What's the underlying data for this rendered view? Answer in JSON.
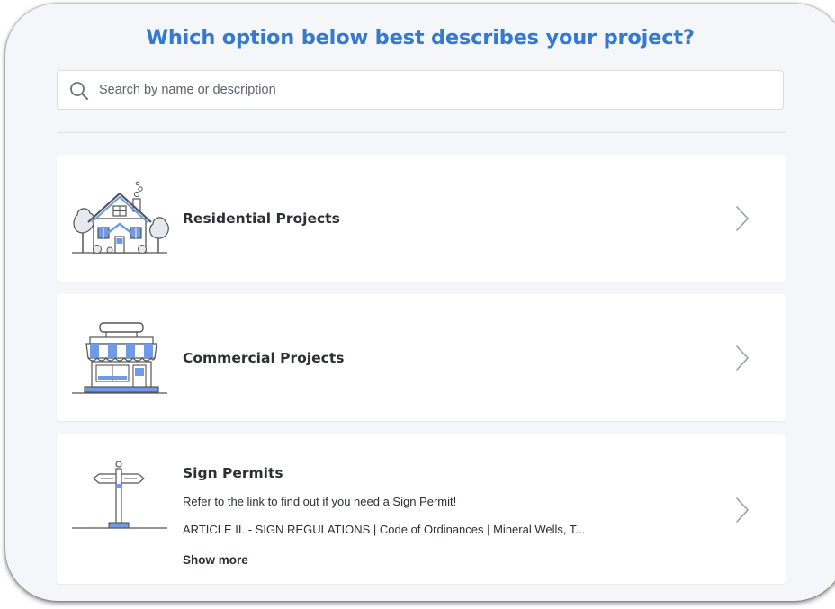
{
  "header": {
    "title": "Which option below best describes your project?"
  },
  "search": {
    "placeholder": "Search by name or description",
    "value": ""
  },
  "options": [
    {
      "title": "Residential Projects",
      "icon": "house-illustration-icon"
    },
    {
      "title": "Commercial Projects",
      "icon": "storefront-illustration-icon"
    },
    {
      "title": "Sign Permits",
      "icon": "signpost-illustration-icon",
      "description": "Refer to the link to find out if you need a Sign Permit!",
      "link_text": "ARTICLE II. - SIGN REGULATIONS | Code of Ordinances | Mineral Wells, T...",
      "show_more": "Show more"
    }
  ],
  "colors": {
    "accent": "#3579d0",
    "illustration_blue": "#6f9be6",
    "background": "#f4f6fa",
    "card": "#ffffff",
    "text": "#2c2f36"
  }
}
